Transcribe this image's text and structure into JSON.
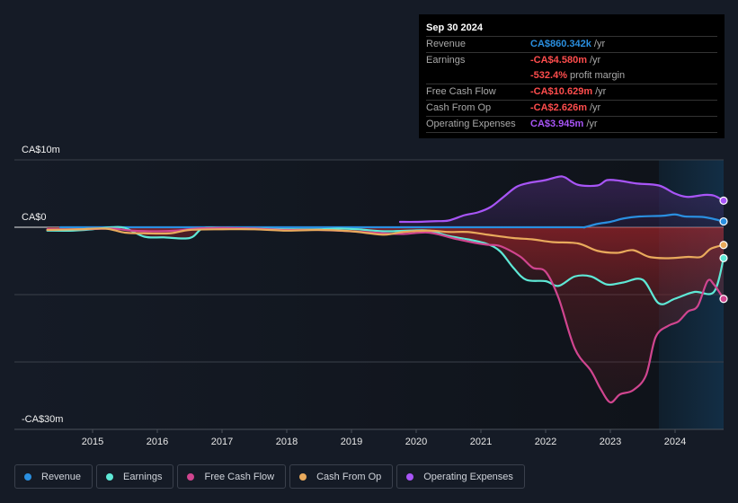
{
  "tooltip": {
    "date": "Sep 30 2024",
    "rows": [
      {
        "label": "Revenue",
        "value": "CA$860.342k",
        "unit": "/yr",
        "color": "#2a8fe0"
      },
      {
        "label": "Earnings",
        "value": "-CA$4.580m",
        "unit": "/yr",
        "color": "#ff4d4d"
      },
      {
        "label": "",
        "value": "-532.4%",
        "unit": "profit margin",
        "color": "#ff4d4d"
      },
      {
        "label": "Free Cash Flow",
        "value": "-CA$10.629m",
        "unit": "/yr",
        "color": "#ff4d4d"
      },
      {
        "label": "Cash From Op",
        "value": "-CA$2.626m",
        "unit": "/yr",
        "color": "#ff4d4d"
      },
      {
        "label": "Operating Expenses",
        "value": "CA$3.945m",
        "unit": "/yr",
        "color": "#a855f7"
      }
    ]
  },
  "chart_data": {
    "type": "line",
    "title": "",
    "xlabel": "",
    "ylabel": "",
    "ylim": [
      -30,
      10
    ],
    "xlim": [
      2014.3,
      2024.75
    ],
    "y_tick_labels": [
      {
        "value": 10,
        "label": "CA$10m"
      },
      {
        "value": 0,
        "label": "CA$0"
      },
      {
        "value": -30,
        "label": "-CA$30m"
      }
    ],
    "gridlines": [
      10,
      0,
      -10,
      -20,
      -30
    ],
    "x_ticks": [
      "2015",
      "2016",
      "2017",
      "2018",
      "2019",
      "2020",
      "2021",
      "2022",
      "2023",
      "2024"
    ],
    "highlight_from": 2023.75,
    "legend_position": "bottom-left",
    "series": [
      {
        "name": "Revenue",
        "color": "#2a8fe0",
        "fill": false,
        "points": [
          [
            2014.5,
            0.0
          ],
          [
            2015.5,
            0.0
          ],
          [
            2016.5,
            0.0
          ],
          [
            2017.5,
            0.0
          ],
          [
            2018.5,
            0.0
          ],
          [
            2019.5,
            0.0
          ],
          [
            2020.5,
            0.0
          ],
          [
            2021.5,
            0.0
          ],
          [
            2022.5,
            0.0
          ],
          [
            2022.6,
            0.0
          ],
          [
            2022.8,
            0.5
          ],
          [
            2023.0,
            0.8
          ],
          [
            2023.2,
            1.3
          ],
          [
            2023.45,
            1.6
          ],
          [
            2023.8,
            1.7
          ],
          [
            2024.0,
            1.9
          ],
          [
            2024.15,
            1.6
          ],
          [
            2024.45,
            1.5
          ],
          [
            2024.75,
            0.86
          ]
        ]
      },
      {
        "name": "Earnings",
        "color": "#5ee8d6",
        "fill": true,
        "points": [
          [
            2014.3,
            -0.5
          ],
          [
            2014.7,
            -0.5
          ],
          [
            2015.0,
            -0.3
          ],
          [
            2015.3,
            0.0
          ],
          [
            2015.5,
            -0.1
          ],
          [
            2015.8,
            -1.4
          ],
          [
            2016.1,
            -1.5
          ],
          [
            2016.5,
            -1.6
          ],
          [
            2016.7,
            -0.2
          ],
          [
            2017.0,
            -0.1
          ],
          [
            2017.5,
            -0.2
          ],
          [
            2018.0,
            -0.3
          ],
          [
            2018.5,
            -0.3
          ],
          [
            2018.8,
            -0.2
          ],
          [
            2019.1,
            -0.3
          ],
          [
            2019.5,
            -0.6
          ],
          [
            2019.9,
            -0.5
          ],
          [
            2020.2,
            -0.5
          ],
          [
            2020.5,
            -1.3
          ],
          [
            2020.8,
            -1.8
          ],
          [
            2021.1,
            -2.5
          ],
          [
            2021.3,
            -3.6
          ],
          [
            2021.5,
            -6.0
          ],
          [
            2021.7,
            -7.8
          ],
          [
            2022.0,
            -8.0
          ],
          [
            2022.2,
            -8.7
          ],
          [
            2022.45,
            -7.3
          ],
          [
            2022.7,
            -7.3
          ],
          [
            2022.95,
            -8.5
          ],
          [
            2023.2,
            -8.2
          ],
          [
            2023.5,
            -7.8
          ],
          [
            2023.75,
            -11.3
          ],
          [
            2024.0,
            -10.6
          ],
          [
            2024.3,
            -9.6
          ],
          [
            2024.6,
            -9.6
          ],
          [
            2024.75,
            -4.58
          ]
        ]
      },
      {
        "name": "Free Cash Flow",
        "color": "#d0458f",
        "fill": true,
        "points": [
          [
            2014.3,
            -0.3
          ],
          [
            2014.8,
            -0.3
          ],
          [
            2015.3,
            -0.2
          ],
          [
            2015.6,
            -0.5
          ],
          [
            2016.0,
            -0.6
          ],
          [
            2016.3,
            -0.5
          ],
          [
            2016.6,
            -0.2
          ],
          [
            2017.0,
            -0.1
          ],
          [
            2017.5,
            -0.2
          ],
          [
            2018.0,
            -0.4
          ],
          [
            2018.5,
            -0.4
          ],
          [
            2019.0,
            -0.6
          ],
          [
            2019.5,
            -0.9
          ],
          [
            2019.8,
            -1.0
          ],
          [
            2020.2,
            -0.8
          ],
          [
            2020.6,
            -1.7
          ],
          [
            2020.9,
            -2.3
          ],
          [
            2021.1,
            -2.6
          ],
          [
            2021.3,
            -2.8
          ],
          [
            2021.6,
            -4.3
          ],
          [
            2021.8,
            -6.0
          ],
          [
            2022.0,
            -6.6
          ],
          [
            2022.2,
            -10.5
          ],
          [
            2022.45,
            -18.0
          ],
          [
            2022.7,
            -21.3
          ],
          [
            2022.85,
            -24.0
          ],
          [
            2023.0,
            -26.0
          ],
          [
            2023.15,
            -24.8
          ],
          [
            2023.35,
            -24.2
          ],
          [
            2023.55,
            -22.0
          ],
          [
            2023.7,
            -16.3
          ],
          [
            2023.9,
            -14.6
          ],
          [
            2024.05,
            -14.0
          ],
          [
            2024.2,
            -12.5
          ],
          [
            2024.35,
            -11.7
          ],
          [
            2024.5,
            -8.0
          ],
          [
            2024.6,
            -8.5
          ],
          [
            2024.75,
            -10.63
          ]
        ]
      },
      {
        "name": "Cash From Op",
        "color": "#e9aa5c",
        "fill": false,
        "points": [
          [
            2014.3,
            -0.4
          ],
          [
            2014.8,
            -0.3
          ],
          [
            2015.2,
            -0.2
          ],
          [
            2015.5,
            -0.8
          ],
          [
            2015.8,
            -0.9
          ],
          [
            2016.2,
            -0.9
          ],
          [
            2016.5,
            -0.4
          ],
          [
            2017.0,
            -0.3
          ],
          [
            2017.5,
            -0.3
          ],
          [
            2018.0,
            -0.5
          ],
          [
            2018.5,
            -0.4
          ],
          [
            2019.0,
            -0.6
          ],
          [
            2019.5,
            -1.1
          ],
          [
            2019.8,
            -0.7
          ],
          [
            2020.2,
            -0.5
          ],
          [
            2020.5,
            -0.7
          ],
          [
            2020.8,
            -0.7
          ],
          [
            2021.1,
            -1.1
          ],
          [
            2021.5,
            -1.6
          ],
          [
            2021.8,
            -1.8
          ],
          [
            2022.1,
            -2.2
          ],
          [
            2022.5,
            -2.4
          ],
          [
            2022.8,
            -3.5
          ],
          [
            2023.1,
            -3.8
          ],
          [
            2023.35,
            -3.4
          ],
          [
            2023.6,
            -4.4
          ],
          [
            2023.9,
            -4.6
          ],
          [
            2024.2,
            -4.4
          ],
          [
            2024.4,
            -4.4
          ],
          [
            2024.55,
            -3.2
          ],
          [
            2024.75,
            -2.63
          ]
        ]
      },
      {
        "name": "Operating Expenses",
        "color": "#a855f7",
        "fill": true,
        "points": [
          [
            2019.75,
            0.8
          ],
          [
            2020.0,
            0.8
          ],
          [
            2020.3,
            0.9
          ],
          [
            2020.5,
            1.0
          ],
          [
            2020.75,
            1.8
          ],
          [
            2020.95,
            2.2
          ],
          [
            2021.15,
            3.0
          ],
          [
            2021.35,
            4.5
          ],
          [
            2021.55,
            6.0
          ],
          [
            2021.75,
            6.6
          ],
          [
            2022.0,
            7.0
          ],
          [
            2022.2,
            7.5
          ],
          [
            2022.3,
            7.4
          ],
          [
            2022.5,
            6.3
          ],
          [
            2022.8,
            6.2
          ],
          [
            2022.95,
            7.0
          ],
          [
            2023.15,
            6.9
          ],
          [
            2023.4,
            6.5
          ],
          [
            2023.75,
            6.2
          ],
          [
            2024.0,
            5.0
          ],
          [
            2024.2,
            4.5
          ],
          [
            2024.45,
            4.8
          ],
          [
            2024.6,
            4.7
          ],
          [
            2024.75,
            3.95
          ]
        ]
      }
    ]
  },
  "legend": [
    {
      "label": "Revenue",
      "color": "#2a8fe0"
    },
    {
      "label": "Earnings",
      "color": "#5ee8d6"
    },
    {
      "label": "Free Cash Flow",
      "color": "#d0458f"
    },
    {
      "label": "Cash From Op",
      "color": "#e9aa5c"
    },
    {
      "label": "Operating Expenses",
      "color": "#a855f7"
    }
  ]
}
